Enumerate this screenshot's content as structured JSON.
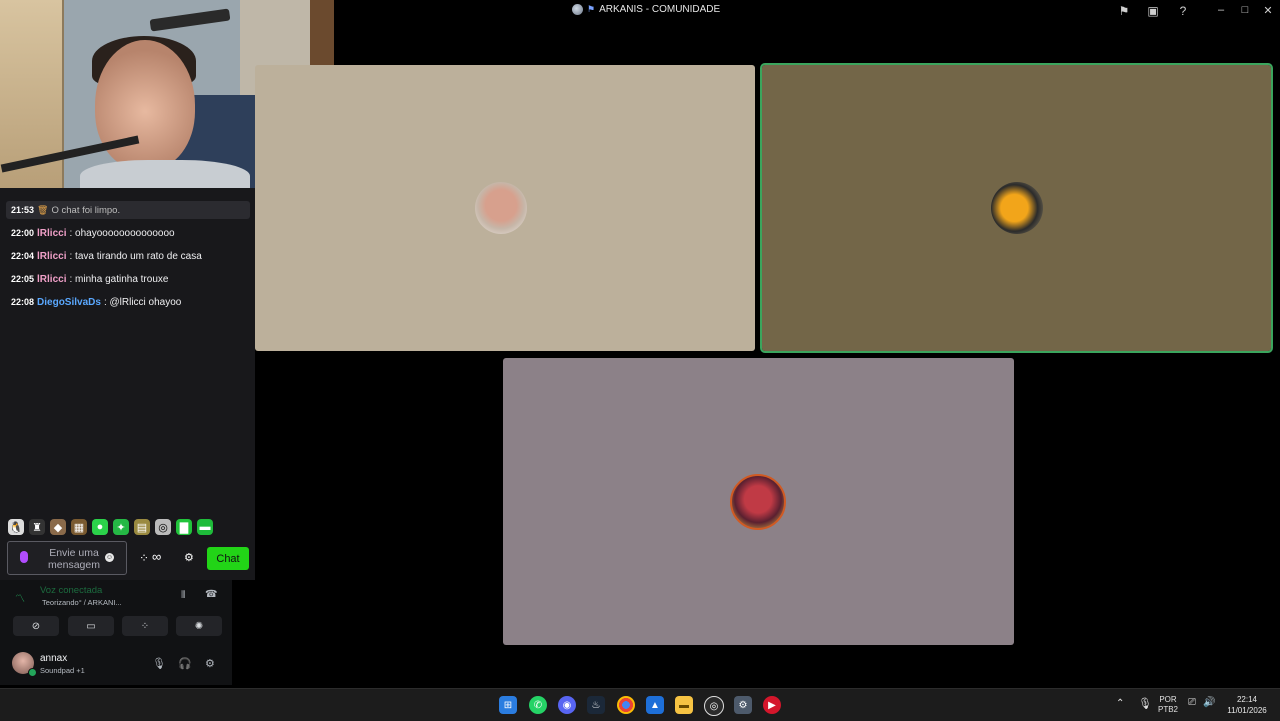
{
  "window": {
    "title": "ARKANIS - COMUNIDADE",
    "icons": [
      "globe-icon",
      "server-icon",
      "inbox-icon",
      "help-icon",
      "minimize-icon",
      "maximize-icon",
      "close-icon"
    ]
  },
  "chat": {
    "system": {
      "time": "21:53",
      "text": "O chat foi limpo."
    },
    "messages": [
      {
        "time": "22:00",
        "user": "lRlicci",
        "color": "#f0a0c8",
        "text": ": ohayoooooooooooooo"
      },
      {
        "time": "22:04",
        "user": "lRlicci",
        "color": "#f0a0c8",
        "text": ": tava tirando um rato de casa"
      },
      {
        "time": "22:05",
        "user": "lRlicci",
        "color": "#f0a0c8",
        "text": ": minha gatinha trouxe"
      },
      {
        "time": "22:08",
        "user": "DiegoSilvaDs",
        "color": "#5aa8ff",
        "text": ": @lRlicci ohayoo"
      }
    ],
    "input_placeholder": "Envie uma mensagem",
    "chat_button": "Chat",
    "infinity": "∞"
  },
  "voice": {
    "status": "Voz conectada",
    "channel": "Teorizando° / ARKANI...",
    "user": {
      "name": "annax",
      "status": "Soundpad +1"
    }
  },
  "taskbar": {
    "lang_line1": "POR",
    "lang_line2": "PTB2",
    "time": "22:14",
    "date": "11/01/2026"
  },
  "colors": {
    "speaking_border": "#3ba55d",
    "chat_button": "#22d417",
    "voice_green": "#23a55a"
  }
}
